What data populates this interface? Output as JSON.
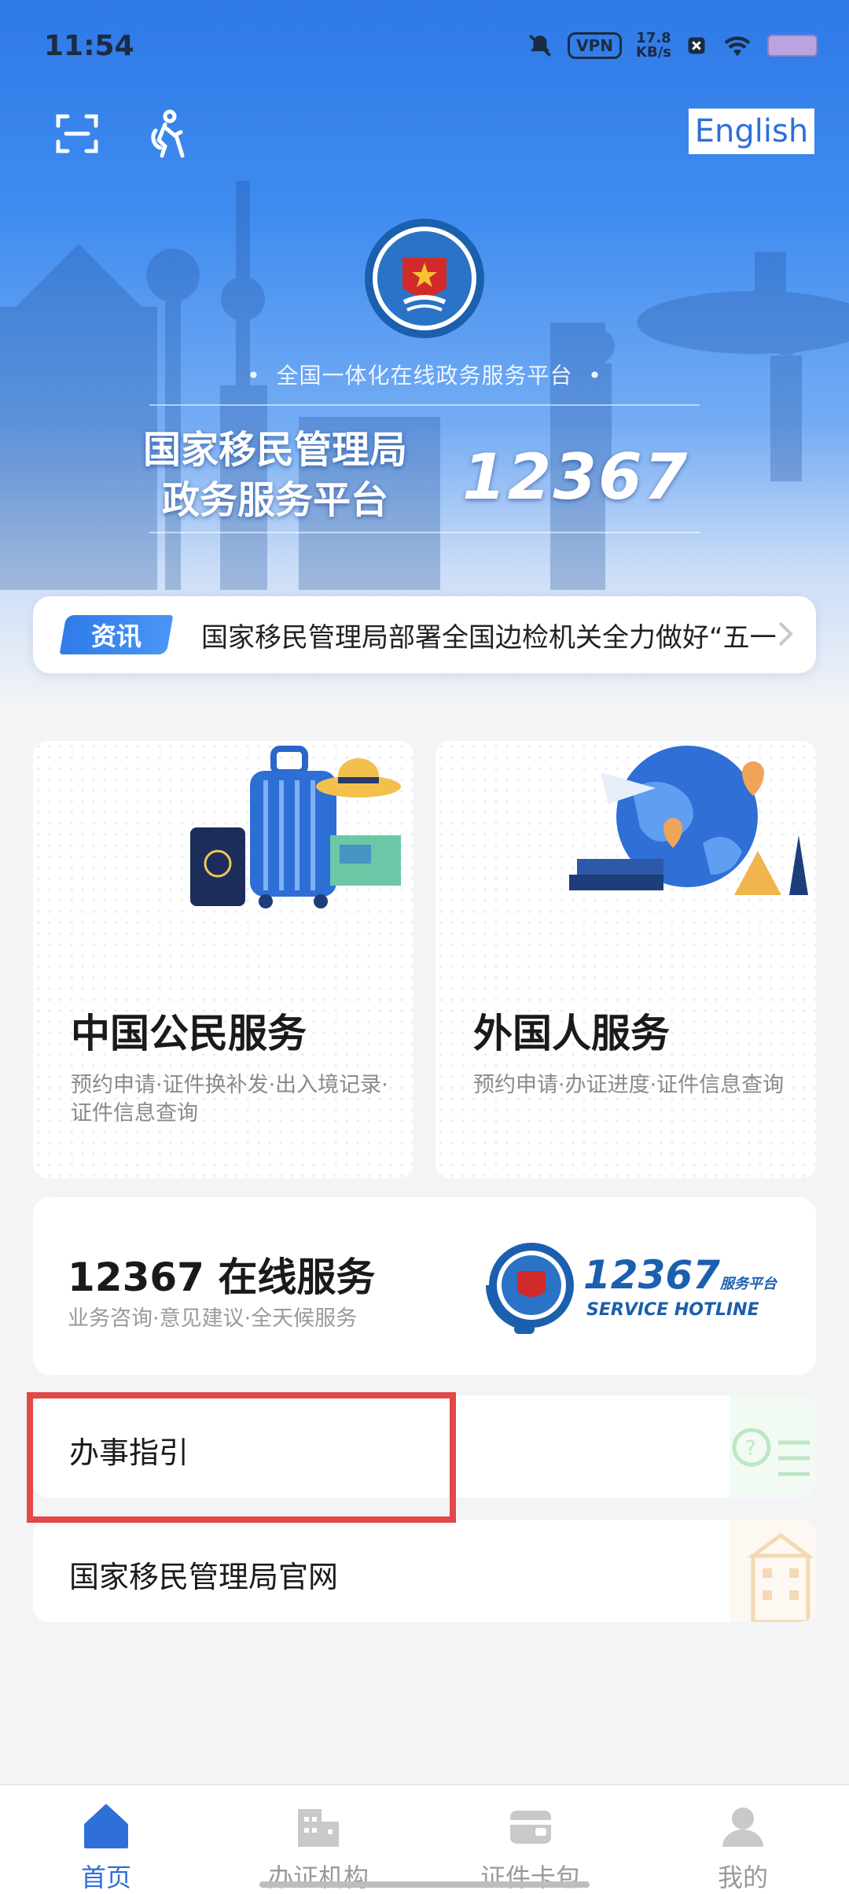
{
  "status_bar": {
    "time": "11:54",
    "vpn_label": "VPN",
    "speed_value": "17.8",
    "speed_unit": "KB/s"
  },
  "header": {
    "language_button": "English",
    "platform_subtitle": "全国一体化在线政务服务平台",
    "title_line1": "国家移民管理局",
    "title_line2": "政务服务平台",
    "hotline_number": "12367"
  },
  "news": {
    "tag": "资讯",
    "headline": "国家移民管理局部署全国边检机关全力做好“五一"
  },
  "services": [
    {
      "title": "中国公民服务",
      "desc": "预约申请·证件换补发·出入境记录·证件信息查询"
    },
    {
      "title": "外国人服务",
      "desc": "预约申请·办证进度·证件信息查询"
    }
  ],
  "hotline": {
    "title": "12367 在线服务",
    "subtitle": "业务咨询·意见建议·全天候服务",
    "logo_number": "12367",
    "logo_tag": "服务平台",
    "logo_en": "SERVICE HOTLINE"
  },
  "rows": [
    {
      "label": "办事指引"
    },
    {
      "label": "国家移民管理局官网"
    }
  ],
  "tabbar": {
    "items": [
      {
        "label": "首页",
        "active": true
      },
      {
        "label": "办证机构",
        "active": false
      },
      {
        "label": "证件卡包",
        "active": false
      },
      {
        "label": "我的",
        "active": false
      }
    ]
  },
  "colors": {
    "accent": "#2f6fd8",
    "highlight": "#e14848",
    "hero": "#3f8cf0"
  }
}
